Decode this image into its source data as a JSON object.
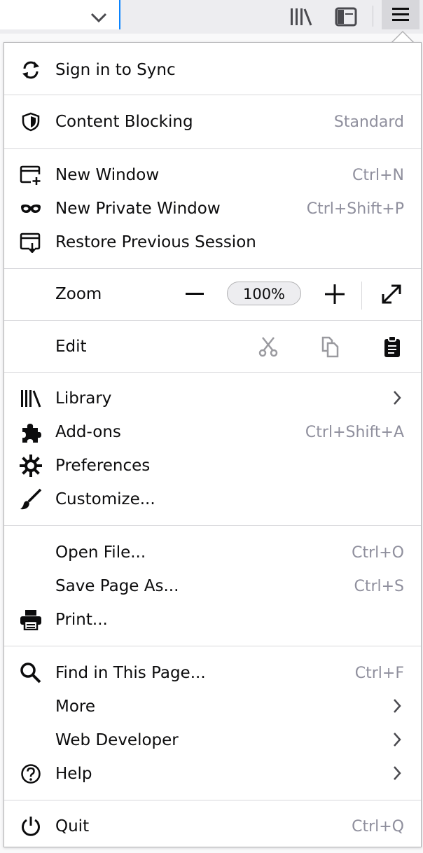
{
  "menu": {
    "sync_label": "Sign in to Sync",
    "content_blocking": {
      "label": "Content Blocking",
      "value": "Standard"
    },
    "new_window": {
      "label": "New Window",
      "shortcut": "Ctrl+N"
    },
    "new_private_window": {
      "label": "New Private Window",
      "shortcut": "Ctrl+Shift+P"
    },
    "restore_session": {
      "label": "Restore Previous Session"
    },
    "zoom": {
      "label": "Zoom",
      "value": "100%"
    },
    "edit": {
      "label": "Edit"
    },
    "library": {
      "label": "Library"
    },
    "addons": {
      "label": "Add-ons",
      "shortcut": "Ctrl+Shift+A"
    },
    "preferences": {
      "label": "Preferences"
    },
    "customize": {
      "label": "Customize..."
    },
    "open_file": {
      "label": "Open File...",
      "shortcut": "Ctrl+O"
    },
    "save_page": {
      "label": "Save Page As...",
      "shortcut": "Ctrl+S"
    },
    "print": {
      "label": "Print..."
    },
    "find": {
      "label": "Find in This Page...",
      "shortcut": "Ctrl+F"
    },
    "more": {
      "label": "More"
    },
    "web_developer": {
      "label": "Web Developer"
    },
    "help": {
      "label": "Help"
    },
    "quit": {
      "label": "Quit",
      "shortcut": "Ctrl+Q"
    }
  },
  "colors": {
    "accent": "#0a84ff",
    "shortcut_text": "#8f8f9d",
    "separator": "#d7d7db"
  }
}
